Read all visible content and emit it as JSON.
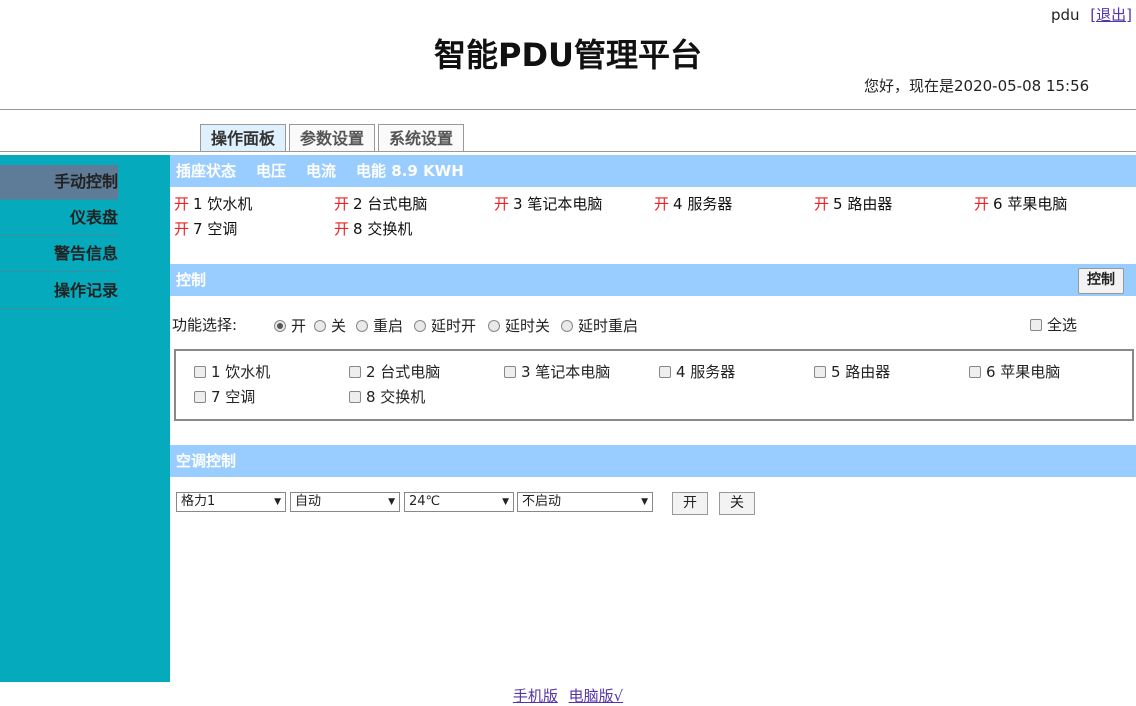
{
  "header": {
    "username": "pdu",
    "logout": "[退出]",
    "title": "智能PDU管理平台",
    "greeting": "您好，现在是2020-05-08 15:56"
  },
  "tabs": [
    "操作面板",
    "参数设置",
    "系统设置"
  ],
  "sidebar": [
    "手动控制",
    "仪表盘",
    "警告信息",
    "操作记录"
  ],
  "status_bar": {
    "title": "插座状态",
    "voltage": "电压",
    "current": "电流",
    "energy": "电能 8.9 KWH"
  },
  "outlets": [
    {
      "state": "开",
      "label": "1 饮水机"
    },
    {
      "state": "开",
      "label": "2 台式电脑"
    },
    {
      "state": "开",
      "label": "3 笔记本电脑"
    },
    {
      "state": "开",
      "label": "4 服务器"
    },
    {
      "state": "开",
      "label": "5 路由器"
    },
    {
      "state": "开",
      "label": "6 苹果电脑"
    },
    {
      "state": "开",
      "label": "7 空调"
    },
    {
      "state": "开",
      "label": "8 交换机"
    }
  ],
  "control": {
    "title": "控制",
    "button": "控制",
    "func_label": "功能选择:",
    "options": [
      "开",
      "关",
      "重启",
      "延时开",
      "延时关",
      "延时重启"
    ],
    "selected": "开",
    "select_all": "全选",
    "checkbox_items": [
      "1 饮水机",
      "2 台式电脑",
      "3 笔记本电脑",
      "4 服务器",
      "5 路由器",
      "6 苹果电脑",
      "7 空调",
      "8 交换机"
    ]
  },
  "ac": {
    "title": "空调控制",
    "brand": "格力1",
    "mode": "自动",
    "temp": "24℃",
    "timer": "不启动",
    "on": "开",
    "off": "关"
  },
  "footer": {
    "mobile": "手机版",
    "desktop": "电脑版√"
  }
}
